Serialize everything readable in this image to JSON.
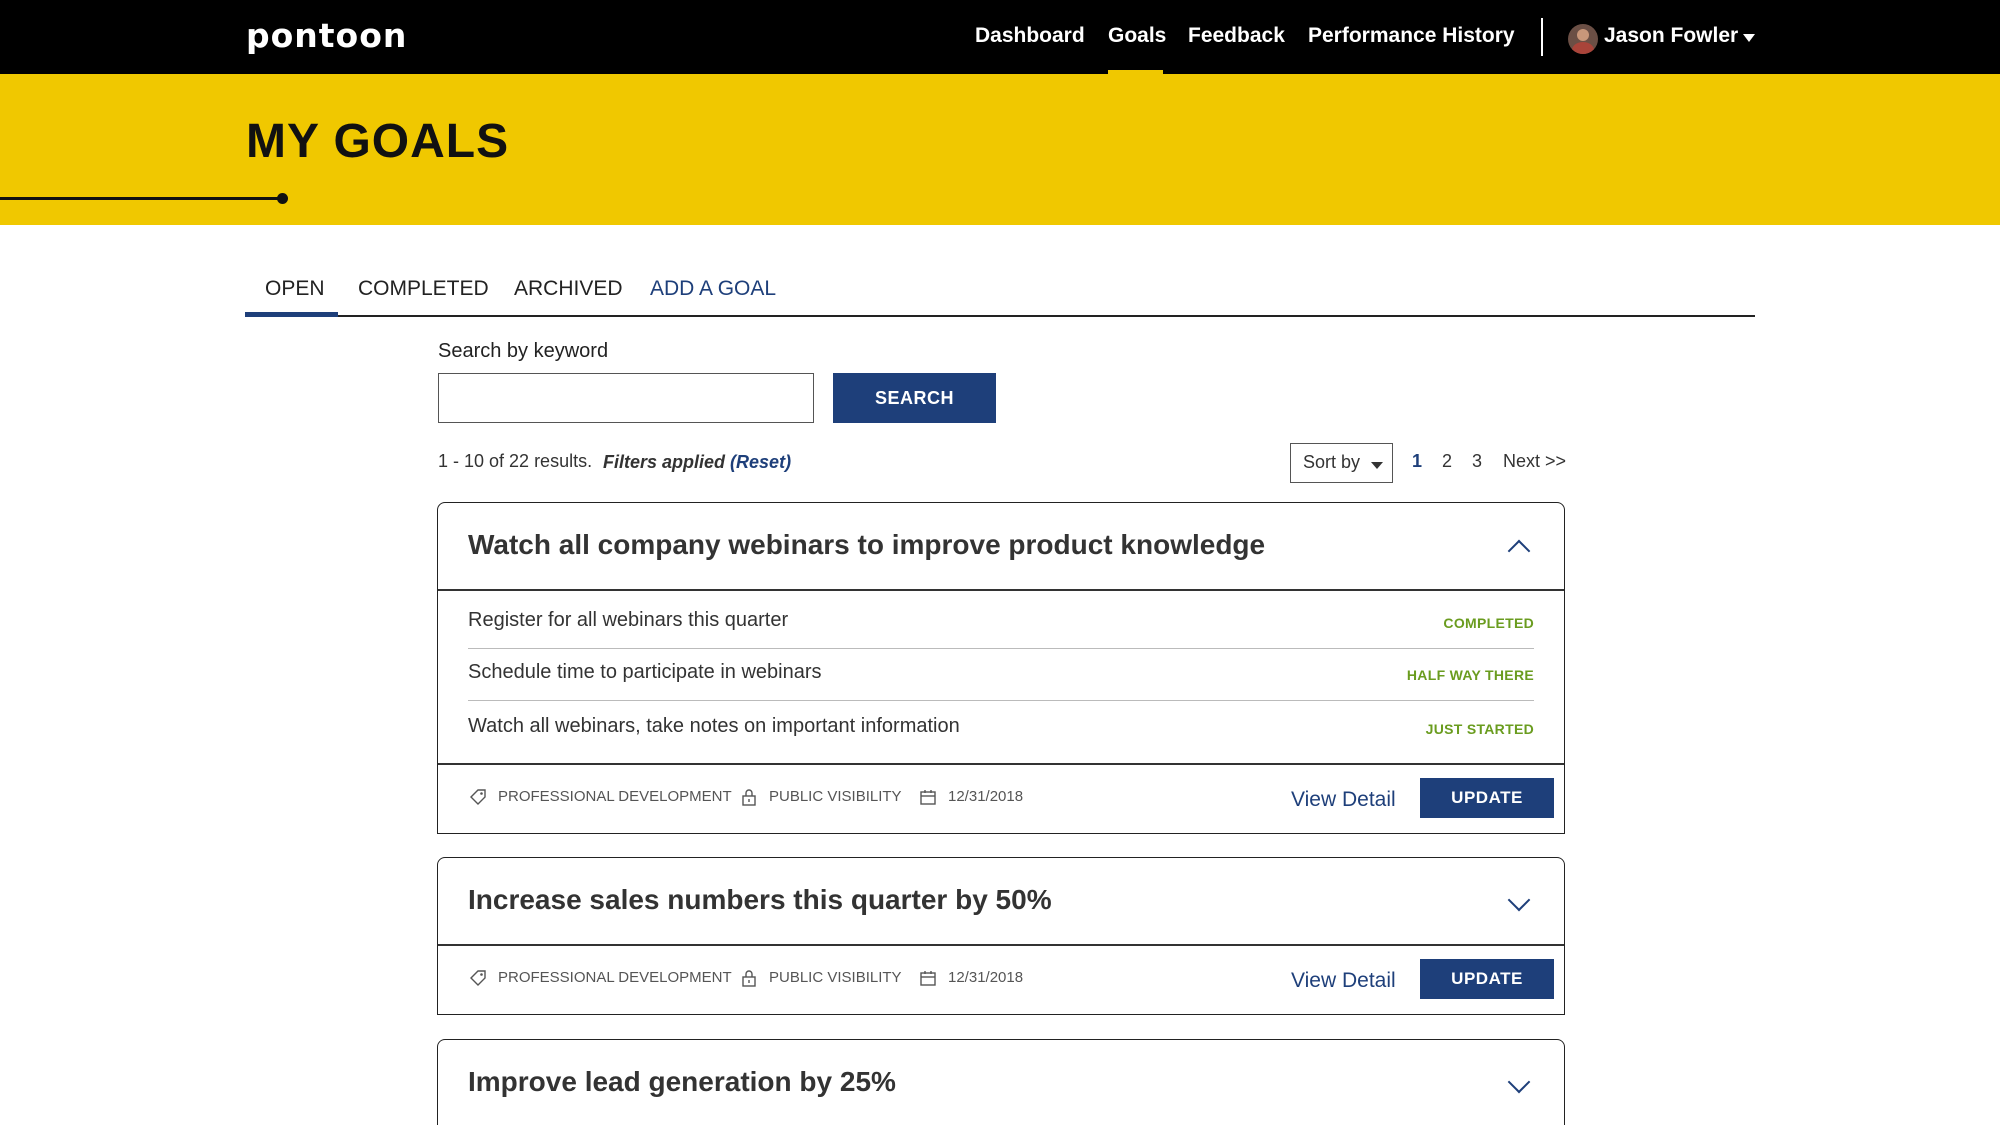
{
  "app": {
    "logo": "pontoon"
  },
  "nav": {
    "links": [
      "Dashboard",
      "Goals",
      "Feedback",
      "Performance History"
    ],
    "user_name": "Jason Fowler",
    "active": "Goals"
  },
  "hero": {
    "title": "MY GOALS"
  },
  "tabs": [
    {
      "label": "OPEN",
      "active": true
    },
    {
      "label": "COMPLETED",
      "active": false
    },
    {
      "label": "ARCHIVED",
      "active": false
    },
    {
      "label": "ADD A GOAL",
      "active": false
    }
  ],
  "search": {
    "label": "Search by keyword",
    "value": "",
    "placeholder": "",
    "button": "SEARCH"
  },
  "results": {
    "count_text": "1 - 10 of 22 results.",
    "filters_text": "Filters applied",
    "reset_text": "(Reset)",
    "sort_label": "Sort by",
    "pages": [
      "1",
      "2",
      "3"
    ],
    "current_page": "1",
    "next_label": "Next >>"
  },
  "goals": [
    {
      "title": "Watch all company webinars to improve product knowledge",
      "expanded": true,
      "tasks": [
        {
          "text": "Register for all webinars this quarter",
          "status": "COMPLETED"
        },
        {
          "text": "Schedule time to participate in webinars",
          "status": "HALF WAY THERE"
        },
        {
          "text": "Watch all webinars, take notes on important information",
          "status": "JUST STARTED"
        }
      ],
      "category": "PROFESSIONAL DEVELOPMENT",
      "visibility": "PUBLIC VISIBILITY",
      "due_date": "12/31/2018",
      "view_detail": "View Detail",
      "update": "UPDATE"
    },
    {
      "title": "Increase sales numbers this quarter by 50%",
      "expanded": false,
      "category": "PROFESSIONAL DEVELOPMENT",
      "visibility": "PUBLIC VISIBILITY",
      "due_date": "12/31/2018",
      "view_detail": "View Detail",
      "update": "UPDATE"
    },
    {
      "title": "Improve lead generation by 25%",
      "expanded": false
    }
  ],
  "colors": {
    "brand_yellow": "#f0c800",
    "primary_blue": "#1e3f7a",
    "status_green": "#6a9c1f",
    "nav_black": "#000000"
  },
  "icons": {
    "tag": "tag-icon",
    "lock": "lock-icon",
    "calendar": "calendar-icon",
    "chevron_up": "chevron-up-icon",
    "chevron_down": "chevron-down-icon",
    "user_menu": "caret-down-icon"
  }
}
